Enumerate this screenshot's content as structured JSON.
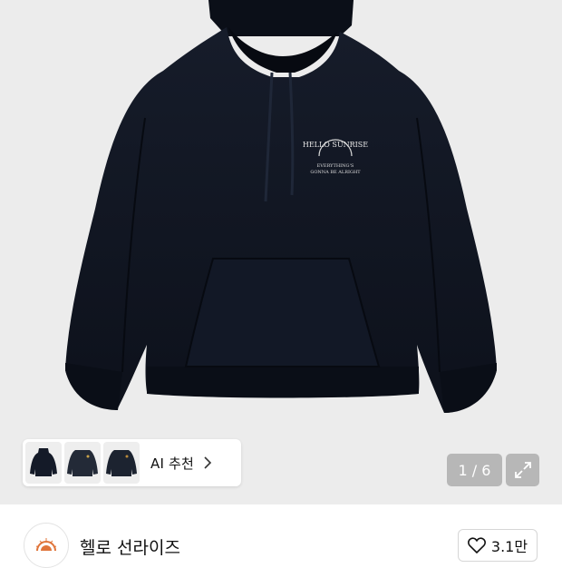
{
  "gallery": {
    "page_indicator": "1 / 6",
    "expand_icon": "expand-arrows-icon",
    "print_text_line1": "HELLO SUNRISE",
    "print_text_line2": "EVERYTHING'S",
    "print_text_line3": "GONNA BE ALRIGHT"
  },
  "ai_recommend": {
    "label": "AI 추천",
    "chevron_icon": "chevron-right-icon",
    "thumbnail_count": 3
  },
  "brand": {
    "name": "헬로 선라이즈",
    "logo_text": "HELLO SUNRISE",
    "logo_color": "#e0753a"
  },
  "like": {
    "icon": "heart-icon",
    "count": "3.1만"
  },
  "colors": {
    "hoodie": "#0f1420",
    "background": "#ececec"
  }
}
